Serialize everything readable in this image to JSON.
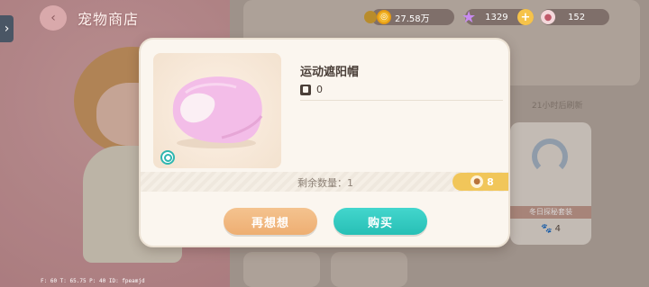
{
  "header": {
    "title": "宠物商店",
    "back_icon": "chevron-left-icon"
  },
  "currency": {
    "gold": "27.58万",
    "star": "1329",
    "paw": "152"
  },
  "background": {
    "refresh_text": "21小时后刷新",
    "card_band": "冬日探秘套装",
    "card_price": "4"
  },
  "modal": {
    "item_name": "运动遮阳帽",
    "owned_count": "0",
    "remaining_label": "剩余数量：1",
    "price": "8",
    "cancel_label": "再想想",
    "buy_label": "购买"
  },
  "debug": "F: 60    T: 65.75    P: 40    ID: fpeamjd",
  "colors": {
    "buy_button": "#2fc5bb",
    "cancel_button": "#f0b57c",
    "price_tag": "#f1c65a",
    "item_pink": "#f3b9e6"
  }
}
